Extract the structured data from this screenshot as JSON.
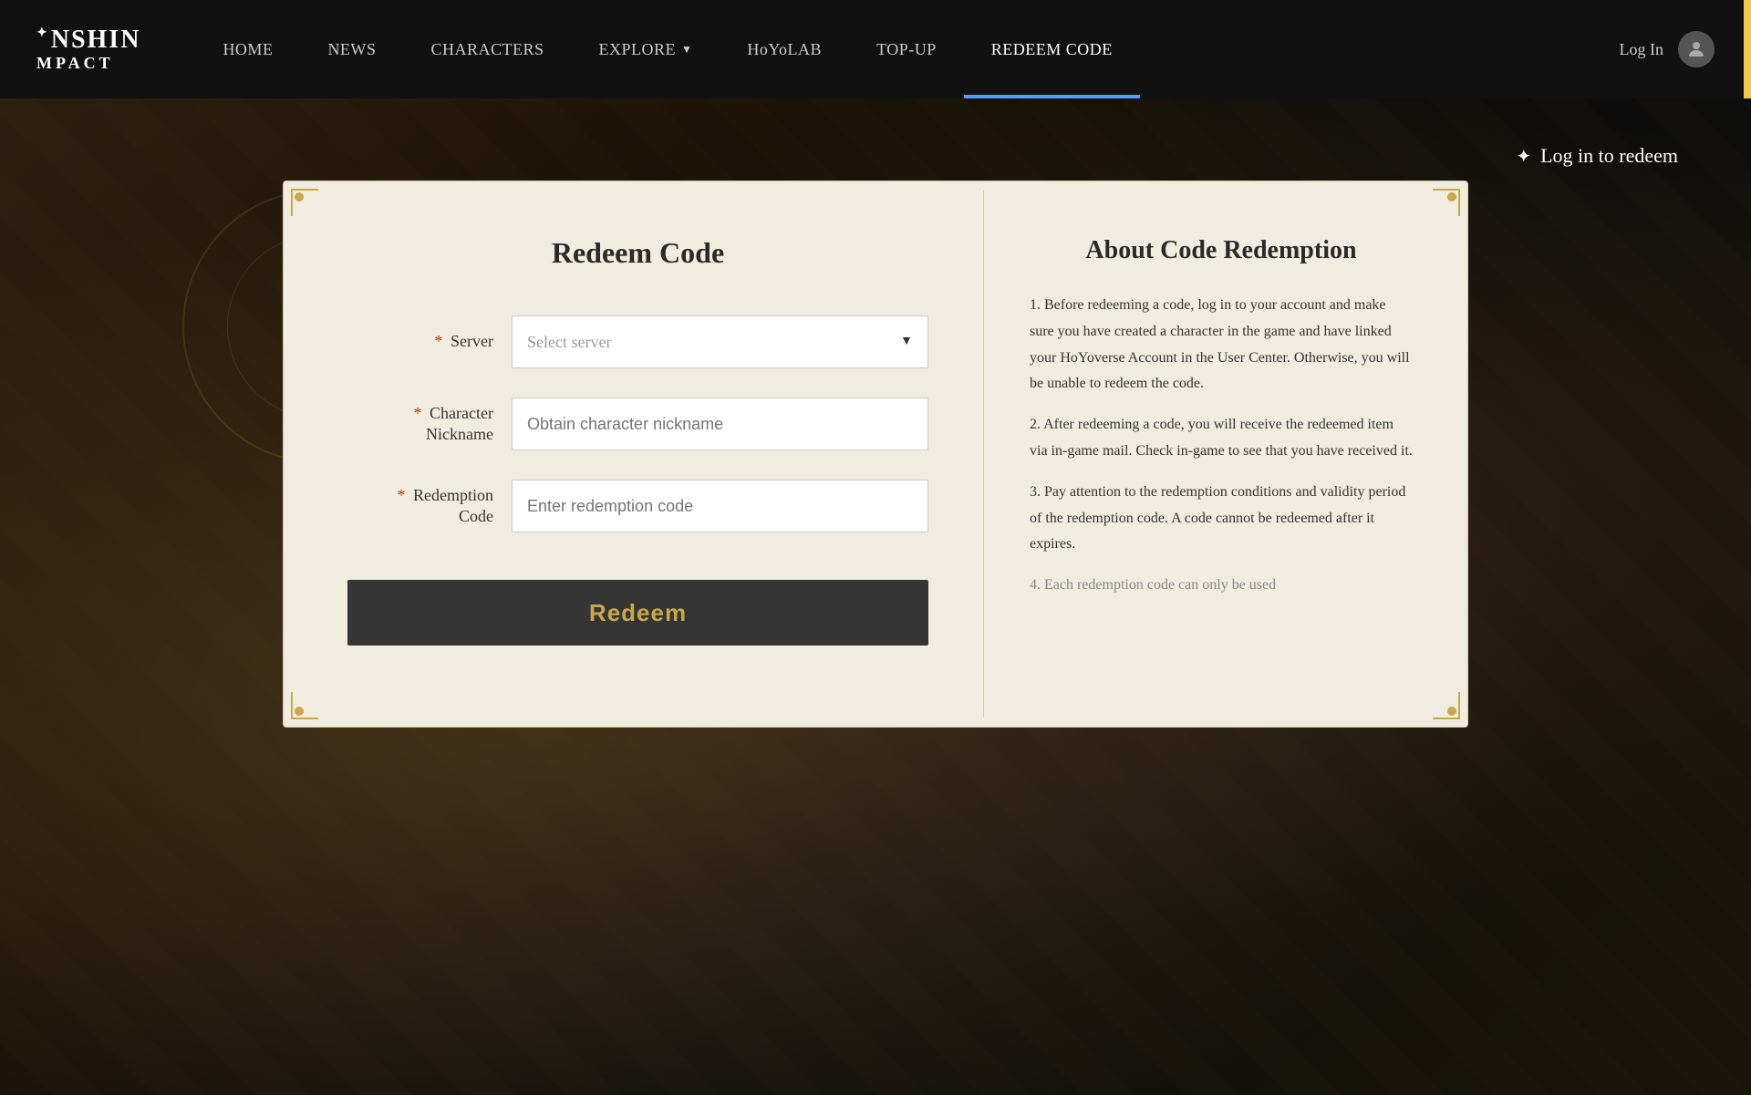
{
  "nav": {
    "logo_line1": "NSHIN",
    "logo_line2": "MPACT",
    "logo_star": "✦",
    "items": [
      {
        "id": "home",
        "label": "HOME",
        "active": false
      },
      {
        "id": "news",
        "label": "NEWS",
        "active": false
      },
      {
        "id": "characters",
        "label": "CHARACTERS",
        "active": false
      },
      {
        "id": "explore",
        "label": "EXPLORE",
        "active": false,
        "has_dropdown": true
      },
      {
        "id": "hoyolab",
        "label": "HoYoLAB",
        "active": false
      },
      {
        "id": "top-up",
        "label": "TOP-UP",
        "active": false
      },
      {
        "id": "redeem-code",
        "label": "REDEEM CODE",
        "active": true
      }
    ],
    "login_label": "Log In"
  },
  "hero": {
    "login_to_redeem": "Log in to redeem"
  },
  "card": {
    "left": {
      "title": "Redeem Code",
      "server_label": "Server",
      "server_placeholder": "Select server",
      "character_label": "Character\nNickname",
      "character_placeholder": "Obtain character nickname",
      "redemption_label": "Redemption\nCode",
      "redemption_placeholder": "Enter redemption code",
      "redeem_button": "Redeem"
    },
    "right": {
      "title": "About Code Redemption",
      "point1": "1. Before redeeming a code, log in to your account and make sure you have created a character in the game and have linked your HoYoverse Account in the User Center. Otherwise, you will be unable to redeem the code.",
      "point2": "2. After redeeming a code, you will receive the redeemed item via in-game mail. Check in-game to see that you have received it.",
      "point3": "3. Pay attention to the redemption conditions and validity period of the redemption code. A code cannot be redeemed after it expires.",
      "point4": "4. Each redemption code can only be used"
    }
  }
}
